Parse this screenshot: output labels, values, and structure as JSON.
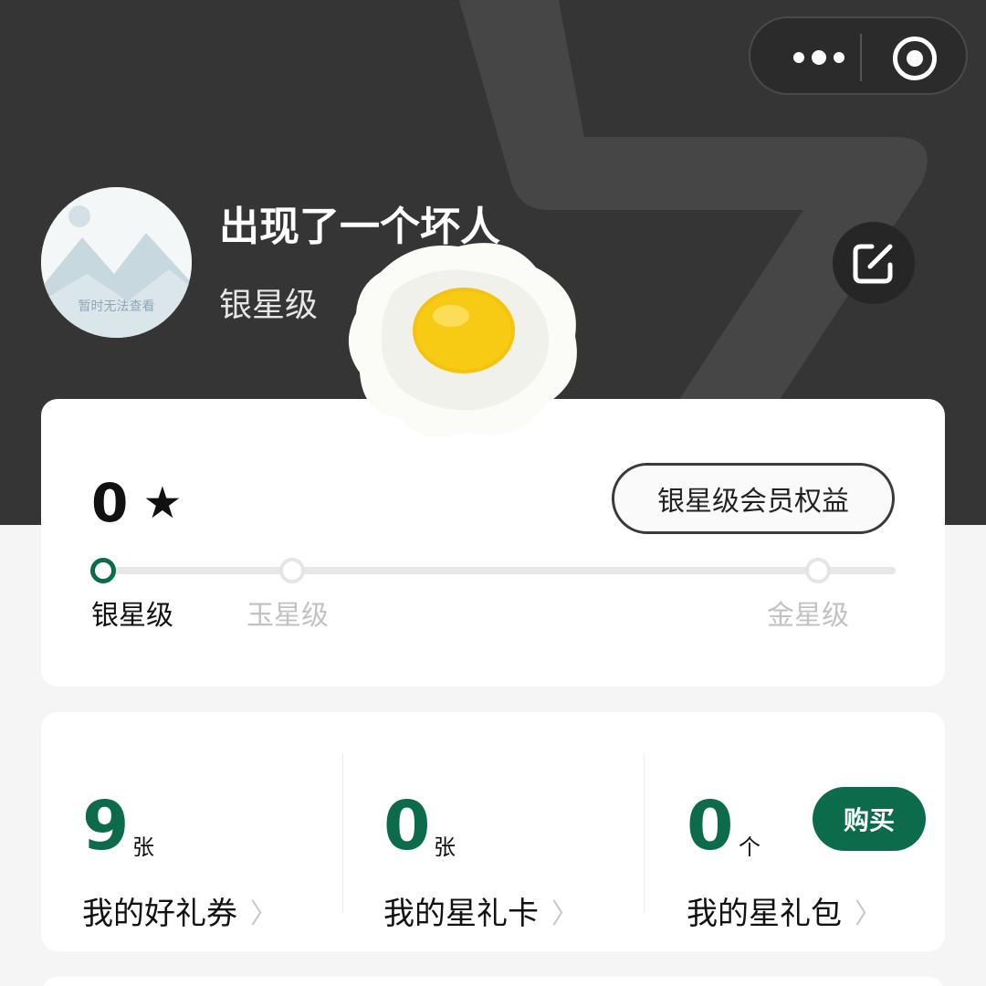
{
  "capsule": {
    "more_icon": "more-dots-icon",
    "close_icon": "target-circle-icon"
  },
  "profile": {
    "avatar_placeholder": "暂时无法查看",
    "username": "出现了一个坏人",
    "level": "银星级",
    "edit_icon": "edit-icon"
  },
  "level_card": {
    "stars": "0",
    "star_icon": "★",
    "benefits_button": "银星级会员权益",
    "levels": [
      {
        "label": "银星级",
        "active": true
      },
      {
        "label": "玉星级",
        "active": false
      },
      {
        "label": "金星级",
        "active": false
      }
    ]
  },
  "assets": [
    {
      "value": "9",
      "unit": "张",
      "label": "我的好礼券"
    },
    {
      "value": "0",
      "unit": "张",
      "label": "我的星礼卡"
    },
    {
      "value": "0",
      "unit": "个",
      "label": "我的星礼包"
    }
  ],
  "buy_button": "购买",
  "colors": {
    "header_bg": "#353535",
    "brand_green": "#0c6b4b",
    "page_bg": "#f5f5f5"
  }
}
